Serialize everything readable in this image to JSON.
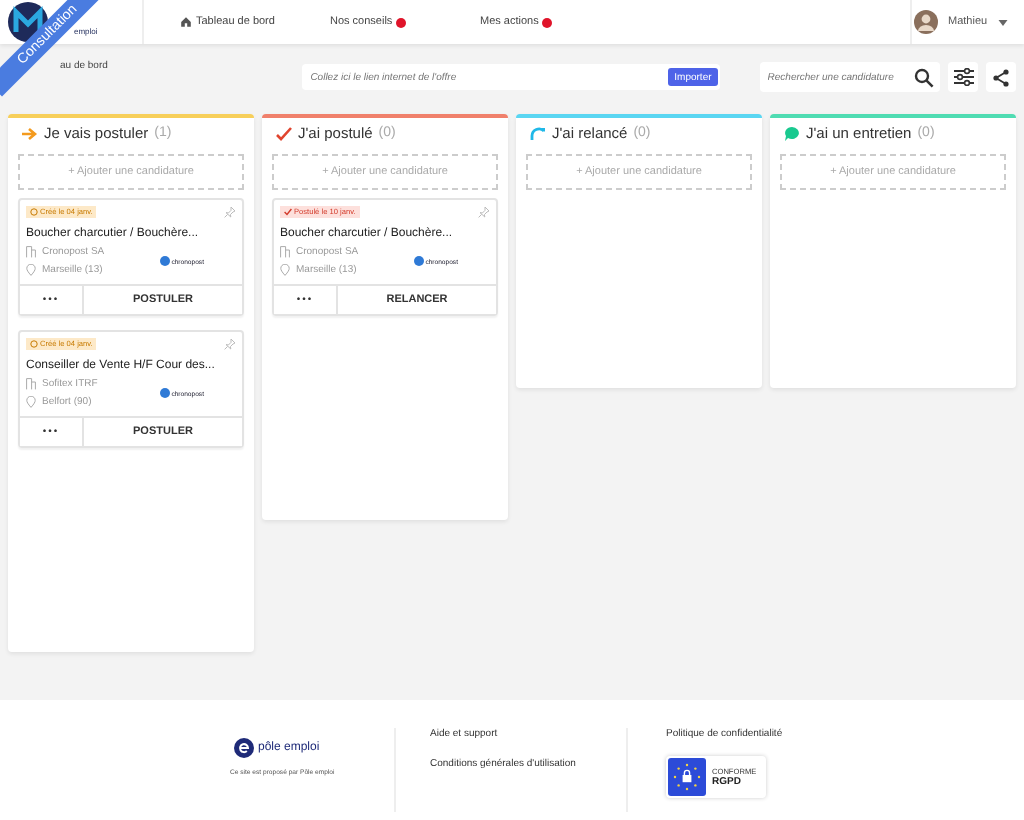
{
  "header": {
    "logo_caption": "emploi",
    "ribbon": "Consultation",
    "nav": [
      {
        "label": "Tableau de bord",
        "kind": "home",
        "badge": false
      },
      {
        "label": "Nos conseils",
        "kind": "link",
        "badge": true
      },
      {
        "label": "Mes actions",
        "kind": "link",
        "badge": true
      }
    ],
    "user": "Mathieu"
  },
  "breadcrumb": "au de bord",
  "link_field": {
    "placeholder": "Collez ici le lien internet de l'offre",
    "button": "Importer"
  },
  "search": {
    "placeholder": "Rechercher une candidature"
  },
  "columns": [
    {
      "title": "Je vais postuler",
      "count": "(1)",
      "color": "#f7cf5a",
      "kind": "todo",
      "add_label": "+ Ajouter une candidature",
      "cards": [
        {
          "kind": "created",
          "status_label": "Créé le 04 janv.",
          "title": "Boucher charcutier / Bouchère...",
          "company": "Cronopost SA",
          "location": "Marseille (13)",
          "company_logo": "chronopost",
          "more": "•••",
          "action": "POSTULER"
        },
        {
          "kind": "created",
          "status_label": "Créé le 04 janv.",
          "title": "Conseiller de Vente H/F Cour des...",
          "company": "Sofitex ITRF",
          "location": "Belfort (90)",
          "company_logo": "chronopost",
          "more": "•••",
          "action": "POSTULER"
        }
      ]
    },
    {
      "title": "J'ai postulé",
      "count": "(0)",
      "color": "#f0806b",
      "kind": "applied",
      "add_label": "+ Ajouter une candidature",
      "cards": [
        {
          "kind": "applied",
          "status_label": "Postulé le 10 janv.",
          "title": "Boucher charcutier / Bouchère...",
          "company": "Cronopost SA",
          "location": "Marseille (13)",
          "company_logo": "chronopost",
          "more": "•••",
          "action": "RELANCER"
        }
      ]
    },
    {
      "title": "J'ai relancé",
      "count": "(0)",
      "color": "#5ad6f2",
      "kind": "followed_up",
      "add_label": "+ Ajouter une candidature"
    },
    {
      "title": "J'ai un entretien",
      "count": "(0)",
      "color": "#4fdcb2",
      "kind": "interview",
      "add_label": "+ Ajouter une candidature"
    }
  ],
  "footer": {
    "logo_text": "pôle emploi",
    "caption": "Ce site est proposé par Pôle emploi",
    "links": [
      "Aide et support",
      "Conditions générales d'utilisation"
    ],
    "privacy": "Politique de confidentialité",
    "badge_top": "CONFORME",
    "badge_bottom": "RGPD"
  }
}
